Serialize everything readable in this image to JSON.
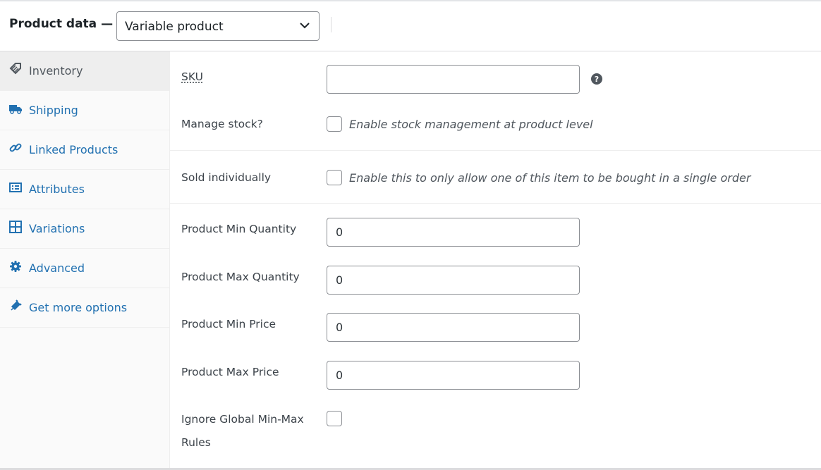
{
  "header": {
    "title": "Product data —",
    "product_type": "Variable product"
  },
  "tabs": [
    {
      "label": "Inventory",
      "icon": "tag-icon",
      "active": true
    },
    {
      "label": "Shipping",
      "icon": "truck-icon",
      "active": false
    },
    {
      "label": "Linked Products",
      "icon": "link-icon",
      "active": false
    },
    {
      "label": "Attributes",
      "icon": "list-icon",
      "active": false
    },
    {
      "label": "Variations",
      "icon": "grid-icon",
      "active": false
    },
    {
      "label": "Advanced",
      "icon": "gear-icon",
      "active": false
    },
    {
      "label": "Get more options",
      "icon": "plugin-icon",
      "active": false
    }
  ],
  "fields": {
    "sku": {
      "label": "SKU",
      "value": ""
    },
    "manage_stock": {
      "label": "Manage stock?",
      "description": "Enable stock management at product level",
      "checked": false
    },
    "sold_individually": {
      "label": "Sold individually",
      "description": "Enable this to only allow one of this item to be bought in a single order",
      "checked": false
    },
    "min_qty": {
      "label": "Product Min Quantity",
      "value": "0"
    },
    "max_qty": {
      "label": "Product Max Quantity",
      "value": "0"
    },
    "min_price": {
      "label": "Product Min Price",
      "value": "0"
    },
    "max_price": {
      "label": "Product Max Price",
      "value": "0"
    },
    "ignore_rules": {
      "label_line1": "Ignore Global Min-Max",
      "label_line2": "Rules",
      "checked": false
    }
  },
  "colors": {
    "link": "#2271b1",
    "active_tab_bg": "#eeeeee",
    "tab_bg": "#fafafa",
    "border": "#8c8f94"
  }
}
